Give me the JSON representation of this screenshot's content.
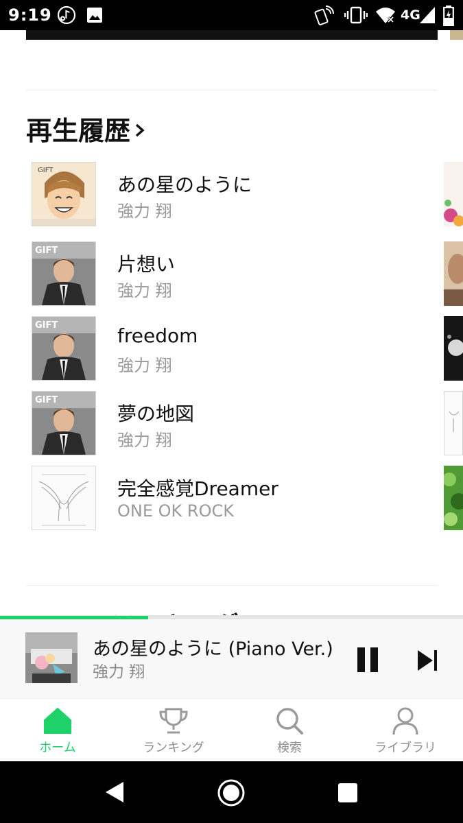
{
  "status_bar": {
    "time": "9:19",
    "network": "4G",
    "icons": [
      "music-notification-icon",
      "image-notification-icon",
      "nfc-icon",
      "vibrate-icon",
      "wifi-icon",
      "signal-icon",
      "battery-icon"
    ]
  },
  "history": {
    "title": "再生履歴",
    "tracks": [
      {
        "title": "あの星のように",
        "artist": "強力 翔",
        "art_label": "GIFT"
      },
      {
        "title": "片想い",
        "artist": "強力 翔",
        "art_label": "GIFT"
      },
      {
        "title": "freedom",
        "artist": "強力 翔",
        "art_label": "GIFT"
      },
      {
        "title": "夢の地図",
        "artist": "強力 翔",
        "art_label": "GIFT"
      },
      {
        "title": "完全感覚Dreamer",
        "artist": "ONE OK ROCK",
        "art_label": ""
      }
    ]
  },
  "next_section": {
    "title": "ランキング"
  },
  "player": {
    "title": "あの星のように (Piano Ver.)",
    "artist": "強力 翔",
    "progress": 0.32
  },
  "tabs": [
    {
      "label": "ホーム",
      "icon": "home-icon",
      "active": true
    },
    {
      "label": "ランキング",
      "icon": "trophy-icon",
      "active": false
    },
    {
      "label": "検索",
      "icon": "search-icon",
      "active": false
    },
    {
      "label": "ライブラリ",
      "icon": "profile-icon",
      "active": false
    }
  ],
  "colors": {
    "accent": "#1fd169",
    "text": "#111111",
    "subtext": "#9a9a9a"
  }
}
